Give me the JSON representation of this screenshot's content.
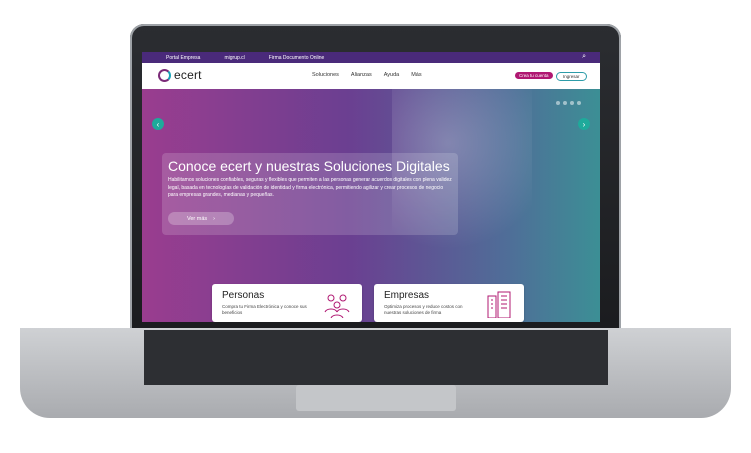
{
  "topbar": {
    "links": [
      "Portal Empresa",
      "migrup.cl",
      "Firma Documento Online"
    ]
  },
  "brand": {
    "name": "ecert"
  },
  "nav": {
    "items": [
      "Soluciones",
      "Alianzas",
      "Ayuda",
      "Más"
    ],
    "cta_primary": "Crea tu cuenta",
    "cta_secondary": "Ingresar"
  },
  "hero": {
    "title": "Conoce ecert y nuestras Soluciones Digitales",
    "text": "Habilitamos soluciones confiables, seguras y flexibles que permiten a las personas generar acuerdos digitales con plena validez legal, basada en tecnologías de validación de identidad y firma electrónica, permitiendo agilizar y crear procesos de negocio para empresas grandes, medianas y pequeñas.",
    "button": "Ver más"
  },
  "cards": [
    {
      "title": "Personas",
      "text": "Compra tu Firma Electrónica y conoce sus beneficios"
    },
    {
      "title": "Empresas",
      "text": "Optimiza procesos y reduce costos con nuestras soluciones de firma"
    }
  ],
  "colors": {
    "topbar": "#4a2a7a",
    "cta_primary": "#b01872",
    "accent": "#1eaa9b"
  }
}
